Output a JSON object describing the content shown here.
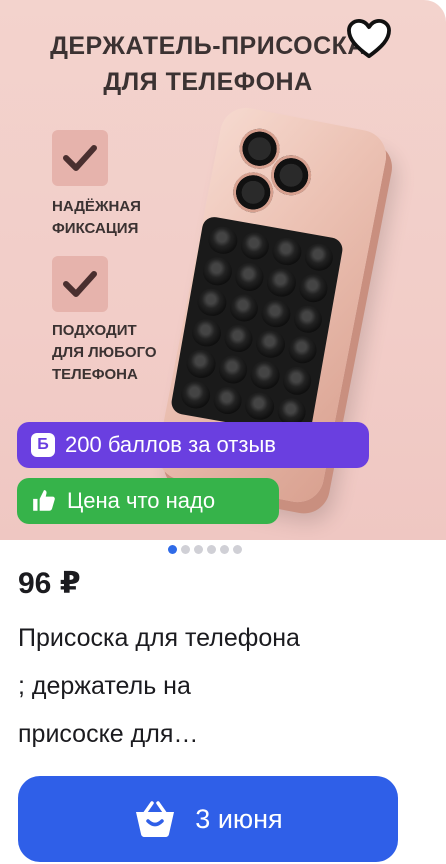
{
  "image": {
    "title_line1": "ДЕРЖАТЕЛЬ-ПРИСОСКА",
    "title_line2": "ДЛЯ ТЕЛЕФОНА",
    "feature1_line1": "НАДЁЖНАЯ",
    "feature1_line2": "ФИКСАЦИЯ",
    "feature2_line1": "ПОДХОДИТ",
    "feature2_line2": "ДЛЯ ЛЮБОГО",
    "feature2_line3": "ТЕЛЕФОНА",
    "carousel_total": 6,
    "carousel_active": 1
  },
  "badges": {
    "points_icon": "Б",
    "points_text": "200 баллов за отзыв",
    "price_text": "Цена что надо"
  },
  "product": {
    "price": "96 ₽",
    "title_line1": "Присоска для телефона",
    "title_line2": "; держатель на",
    "title_line3": "присоске для…"
  },
  "cart": {
    "label": "3 июня"
  },
  "colors": {
    "points_badge": "#6a3fe0",
    "price_badge": "#36b34a",
    "cart_button": "#2f5fe8",
    "active_dot": "#2f6be8"
  },
  "icons": [
    "heart-icon",
    "check-icon",
    "points-icon",
    "thumbs-up-icon",
    "basket-icon"
  ]
}
